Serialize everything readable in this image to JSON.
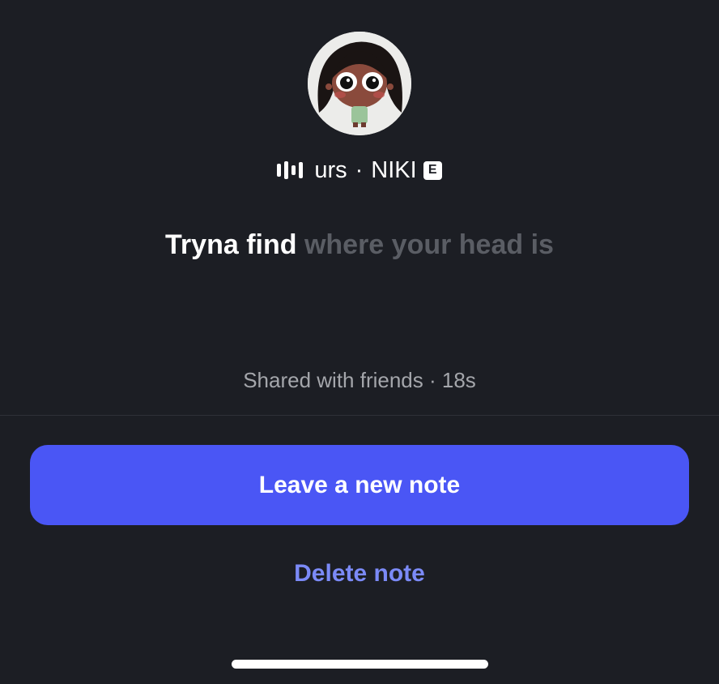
{
  "note": {
    "track": {
      "icon": "music-bars-icon",
      "title": "urs",
      "separator": "·",
      "artist": "NIKI",
      "explicit_label": "E"
    },
    "lyric_active": "Tryna find",
    "lyric_upcoming": "where your head is",
    "meta": "Shared with friends · 18s"
  },
  "actions": {
    "primary_label": "Leave a new note",
    "secondary_label": "Delete note"
  },
  "colors": {
    "background": "#1c1e24",
    "primary_button": "#4a56f5",
    "link": "#7b8af7",
    "dim_text": "#5a5d64"
  }
}
